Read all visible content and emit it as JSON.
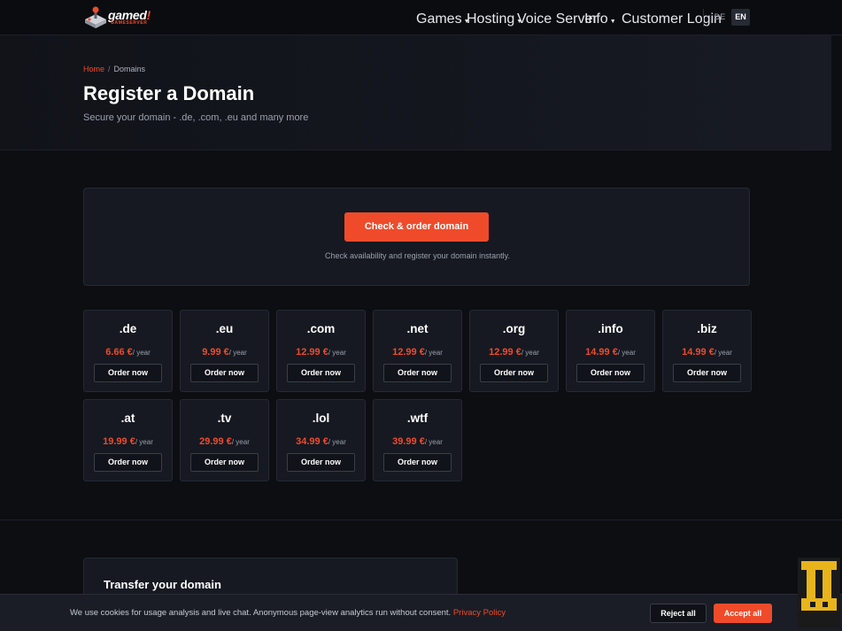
{
  "header": {
    "logo_text": "gamed",
    "logo_bang": "!",
    "logo_sub": "GAMESERVER",
    "nav": [
      {
        "label": "Games",
        "caret": true
      },
      {
        "label": "Hosting",
        "caret": true
      },
      {
        "label": "Voice Server",
        "caret": false
      },
      {
        "label": "Info",
        "caret": true
      },
      {
        "label": "Customer Login",
        "caret": false
      }
    ],
    "languages": [
      "DE",
      "EN"
    ],
    "active_language": "EN"
  },
  "hero": {
    "breadcrumb": [
      "Home",
      "Domains"
    ],
    "title": "Register a Domain",
    "subtitle": "Secure your domain - .de, .com, .eu and many more"
  },
  "check": {
    "button_label": "Check & order domain",
    "note": "Check availability and register your domain instantly."
  },
  "domains": [
    {
      "tld": ".de",
      "price": "6.66 €",
      "period": "/ year",
      "button": "Order now"
    },
    {
      "tld": ".eu",
      "price": "9.99 €",
      "period": "/ year",
      "button": "Order now"
    },
    {
      "tld": ".com",
      "price": "12.99 €",
      "period": "/ year",
      "button": "Order now"
    },
    {
      "tld": ".net",
      "price": "12.99 €",
      "period": "/ year",
      "button": "Order now"
    },
    {
      "tld": ".org",
      "price": "12.99 €",
      "period": "/ year",
      "button": "Order now"
    },
    {
      "tld": ".info",
      "price": "14.99 €",
      "period": "/ year",
      "button": "Order now"
    },
    {
      "tld": ".biz",
      "price": "14.99 €",
      "period": "/ year",
      "button": "Order now"
    },
    {
      "tld": ".at",
      "price": "19.99 €",
      "period": "/ year",
      "button": "Order now"
    },
    {
      "tld": ".tv",
      "price": "29.99 €",
      "period": "/ year",
      "button": "Order now"
    },
    {
      "tld": ".lol",
      "price": "34.99 €",
      "period": "/ year",
      "button": "Order now"
    },
    {
      "tld": ".wtf",
      "price": "39.99 €",
      "period": "/ year",
      "button": "Order now"
    }
  ],
  "transfer": {
    "title": "Transfer your domain"
  },
  "cookie": {
    "text": "We use cookies for usage analysis and live chat. Anonymous page-view analytics run without consent.",
    "link": "Privacy Policy",
    "reject": "Reject all",
    "accept": "Accept all"
  },
  "colors": {
    "accent": "#ef4b2b",
    "background": "#0d0e12",
    "card": "#161921"
  },
  "icons": {
    "logo": "gamepad-joystick-icon",
    "badge": "hosting-badge-icon"
  }
}
